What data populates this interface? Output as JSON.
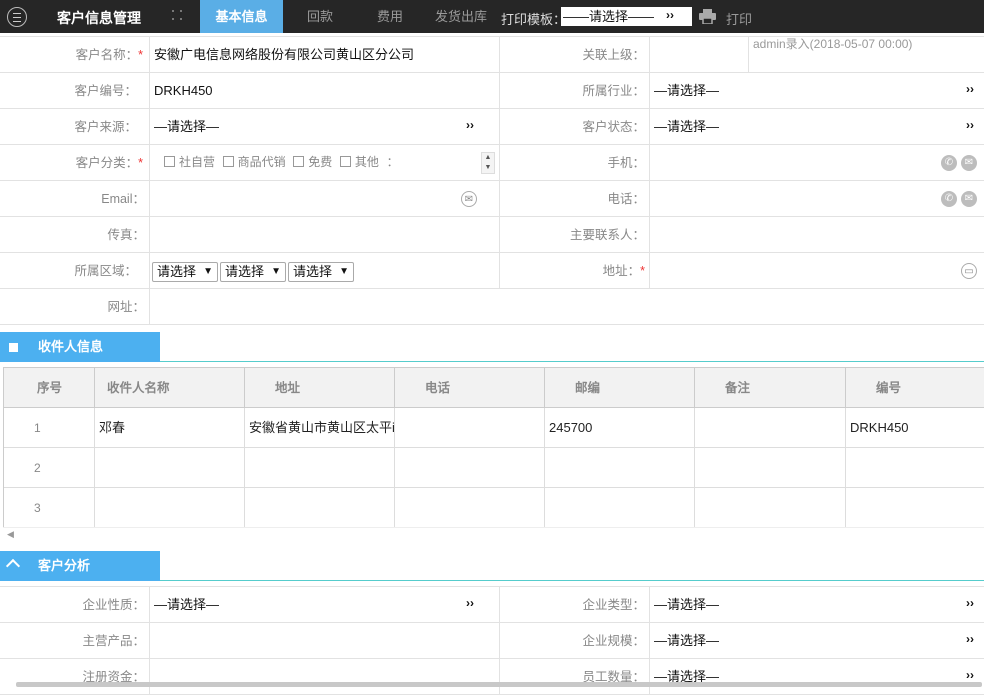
{
  "topbar": {
    "title": "客户信息管理",
    "tabs": [
      "基本信息",
      "回款",
      "费用",
      "发货出库"
    ],
    "print_template_label": "打印模板：",
    "print_template_value": "——请选择——",
    "print_label": "打印"
  },
  "form": {
    "customer_name_label": "客户名称：",
    "customer_name": "安徽广电信息网络股份有限公司黄山区分公司",
    "parent_label": "关联上级：",
    "entry_note": "admin录入(2018-05-07 00:00)",
    "customer_no_label": "客户编号：",
    "customer_no": "DRKH450",
    "industry_label": "所属行业：",
    "industry": "—请选择—",
    "source_label": "客户来源：",
    "source": "—请选择—",
    "status_label": "客户状态：",
    "status": "—请选择—",
    "category_label": "客户分类：",
    "category_options": [
      "社自营",
      "商品代销",
      "免费",
      "其他"
    ],
    "category_colon": "：",
    "mobile_label": "手机：",
    "email_label": "Email：",
    "phone_label": "电话：",
    "fax_label": "传真：",
    "contact_label": "主要联系人：",
    "region_label": "所属区域：",
    "region_selects": [
      "请选择",
      "请选择",
      "请选择"
    ],
    "address_label": "地址：",
    "website_label": "网址：",
    "required_mark": "*",
    "chevron": "››"
  },
  "recipients": {
    "section_title": "收件人信息",
    "columns": [
      "序号",
      "收件人名称",
      "地址",
      "电话",
      "邮编",
      "备注",
      "编号"
    ],
    "rows": [
      [
        "1",
        "邓春",
        "安徽省黄山市黄山区太平i",
        "",
        "245700",
        "",
        "DRKH450"
      ],
      [
        "2",
        "",
        "",
        "",
        "",
        "",
        ""
      ],
      [
        "3",
        "",
        "",
        "",
        "",
        "",
        ""
      ]
    ]
  },
  "analysis": {
    "section_title": "客户分析",
    "nature_label": "企业性质：",
    "nature": "—请选择—",
    "type_label": "企业类型：",
    "type": "—请选择—",
    "products_label": "主营产品：",
    "scale_label": "企业规模：",
    "scale": "—请选择—",
    "capital_label": "注册资金：",
    "staff_label": "员工数量：",
    "staff": "—请选择—"
  },
  "colors": {
    "topbar": "#262626",
    "accent": "#5aaee6",
    "section": "#4cb0f0",
    "required": "#e33333"
  }
}
